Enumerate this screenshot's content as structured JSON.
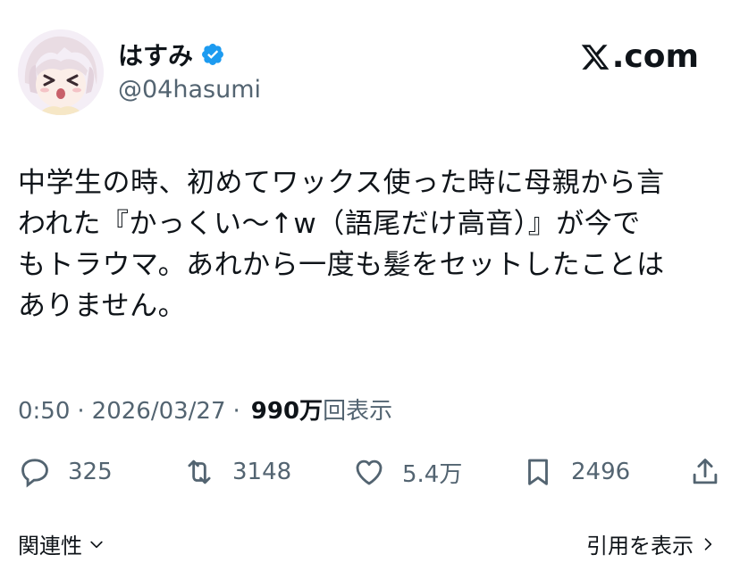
{
  "author": {
    "display_name": "はすみ",
    "handle": "@04hasumi",
    "verified": true
  },
  "brand": {
    "site": "com",
    "accent": "#1d9bf0"
  },
  "tweet": {
    "text": "中学生の時、初めてワックス使った時に母親から言\nわれた『かっくい〜↑w（語尾だけ高音）』が今で\nもトラウマ。あれから一度も髪をセットしたことは\nありません。"
  },
  "meta": {
    "time": "0:50",
    "separator": "·",
    "date": "2026/03/27",
    "views_count": "990万",
    "views_label": "回表示"
  },
  "actions": {
    "reply": {
      "icon": "reply-icon",
      "count": "325"
    },
    "repost": {
      "icon": "repost-icon",
      "count": "3148"
    },
    "like": {
      "icon": "heart-icon",
      "count": "5.4万"
    },
    "bookmark": {
      "icon": "bookmark-icon",
      "count": "2496"
    },
    "share": {
      "icon": "share-icon"
    }
  },
  "footer": {
    "related_label": "関連性",
    "quotes_label": "引用を表示"
  }
}
